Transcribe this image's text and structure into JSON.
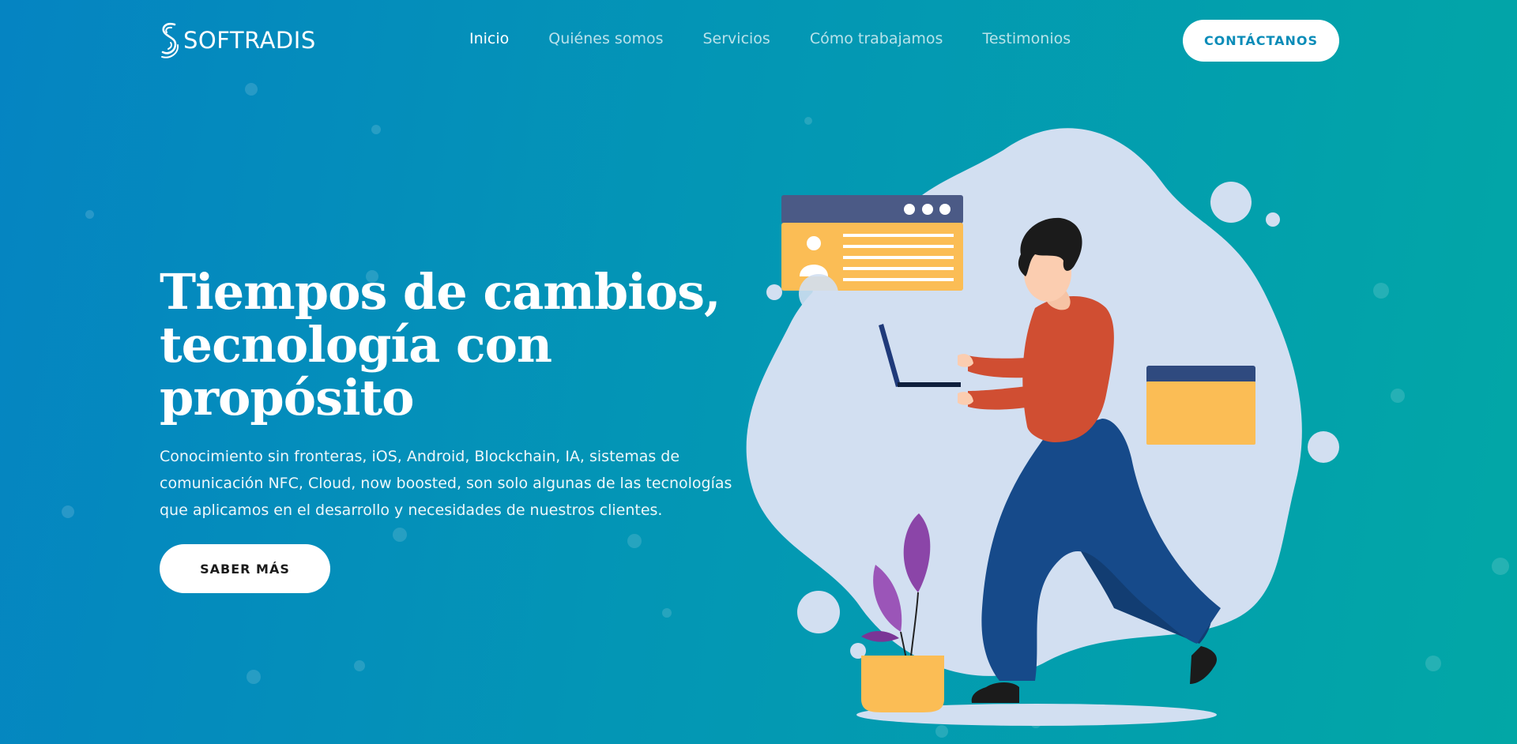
{
  "brand": {
    "name": "SOFTRADIS",
    "logo_icon": "s-wave-logo-icon"
  },
  "nav": {
    "items": [
      {
        "label": "Inicio",
        "active": true
      },
      {
        "label": "Quiénes somos",
        "active": false
      },
      {
        "label": "Servicios",
        "active": false
      },
      {
        "label": "Cómo trabajamos",
        "active": false
      },
      {
        "label": "Testimonios",
        "active": false
      }
    ],
    "contact_label": "CONTÁCTANOS"
  },
  "hero": {
    "title_lines": [
      "Tiempos de cambios,",
      "tecnología con",
      "propósito"
    ],
    "description": "Conocimiento sin fronteras, iOS, Android, Blockchain, IA, sistemas de comunicación NFC, Cloud, now boosted, son solo algunas de las tecnologías que aplicamos en el desarrollo y necesidades de nuestros clientes.",
    "cta_label": "SABER MÁS"
  },
  "colors": {
    "gradient_start": "#0584c2",
    "gradient_end": "#02a7a6",
    "blob": "#d2dff1",
    "card_yellow": "#fbbd55",
    "card_header": "#4b5a86",
    "shirt": "#d04e32",
    "pants": "#164a8a",
    "plant": "#8b45a8"
  }
}
